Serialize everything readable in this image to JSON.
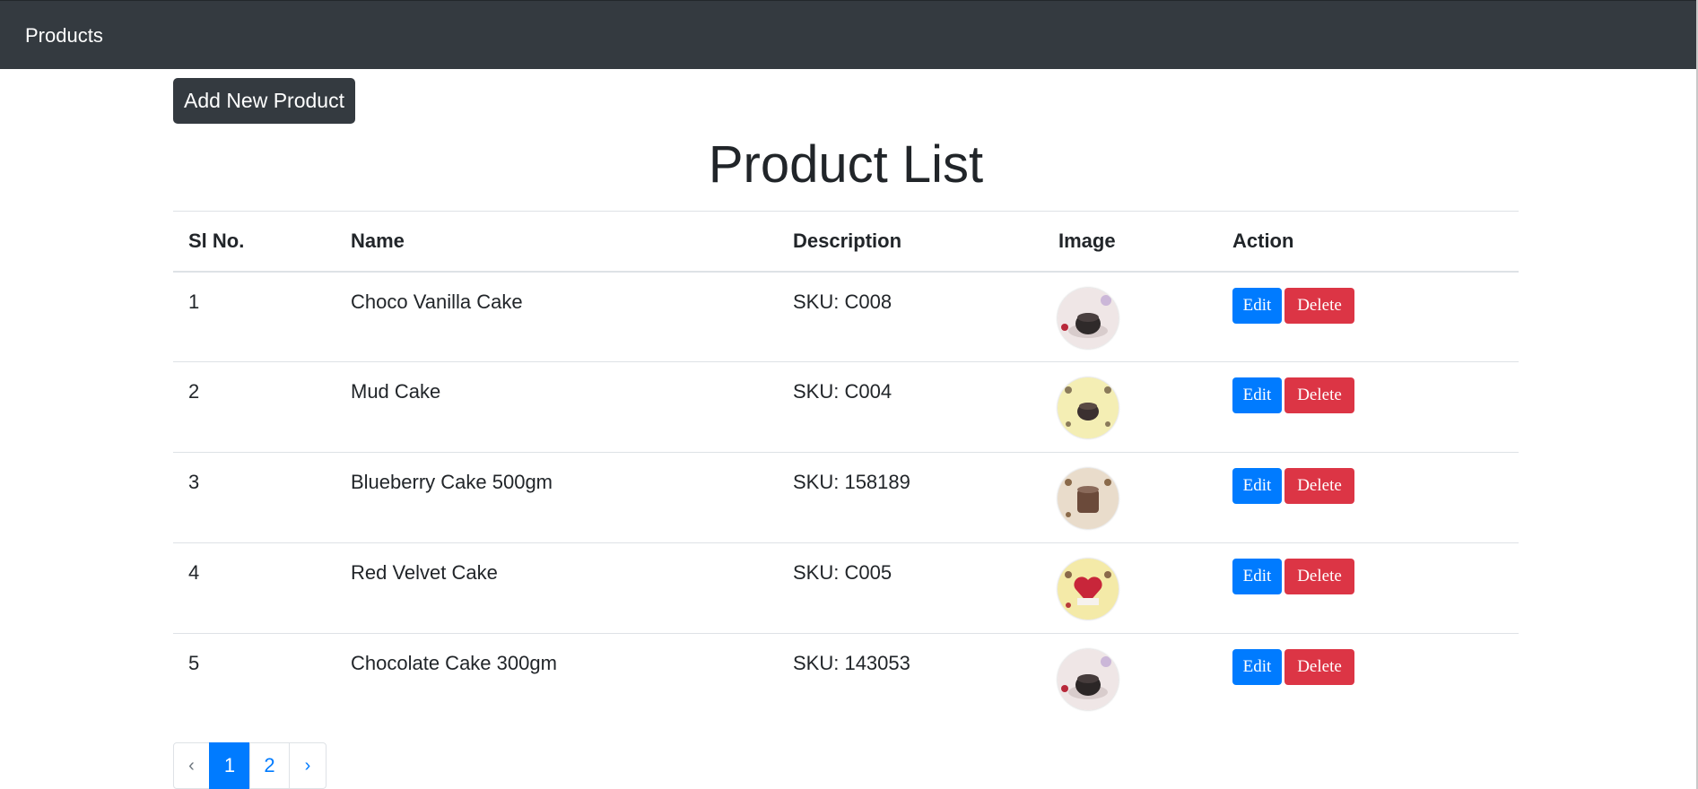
{
  "navbar": {
    "brand": "Products"
  },
  "toolbar": {
    "add_label": "Add New Product"
  },
  "page": {
    "title": "Product List"
  },
  "table": {
    "headers": [
      "Sl No.",
      "Name",
      "Description",
      "Image",
      "Action"
    ],
    "rows": [
      {
        "sl": "1",
        "name": "Choco Vanilla Cake",
        "description": "SKU: C008",
        "image_icon": "cake-thumbnail-icon"
      },
      {
        "sl": "2",
        "name": "Mud Cake",
        "description": "SKU: C004",
        "image_icon": "cake-thumbnail-icon"
      },
      {
        "sl": "3",
        "name": "Blueberry Cake 500gm",
        "description": "SKU: 158189",
        "image_icon": "cake-thumbnail-icon"
      },
      {
        "sl": "4",
        "name": "Red Velvet Cake",
        "description": "SKU: C005",
        "image_icon": "cake-thumbnail-icon"
      },
      {
        "sl": "5",
        "name": "Chocolate Cake 300gm",
        "description": "SKU: 143053",
        "image_icon": "cake-thumbnail-icon"
      }
    ],
    "actions": {
      "edit_label": "Edit",
      "delete_label": "Delete"
    }
  },
  "pagination": {
    "prev": "‹",
    "pages": [
      "1",
      "2"
    ],
    "next": "›",
    "active_page": "1"
  },
  "colors": {
    "navbar": "#343a40",
    "primary": "#007bff",
    "danger": "#dc3545",
    "text": "#212529",
    "border": "#dee2e6"
  }
}
